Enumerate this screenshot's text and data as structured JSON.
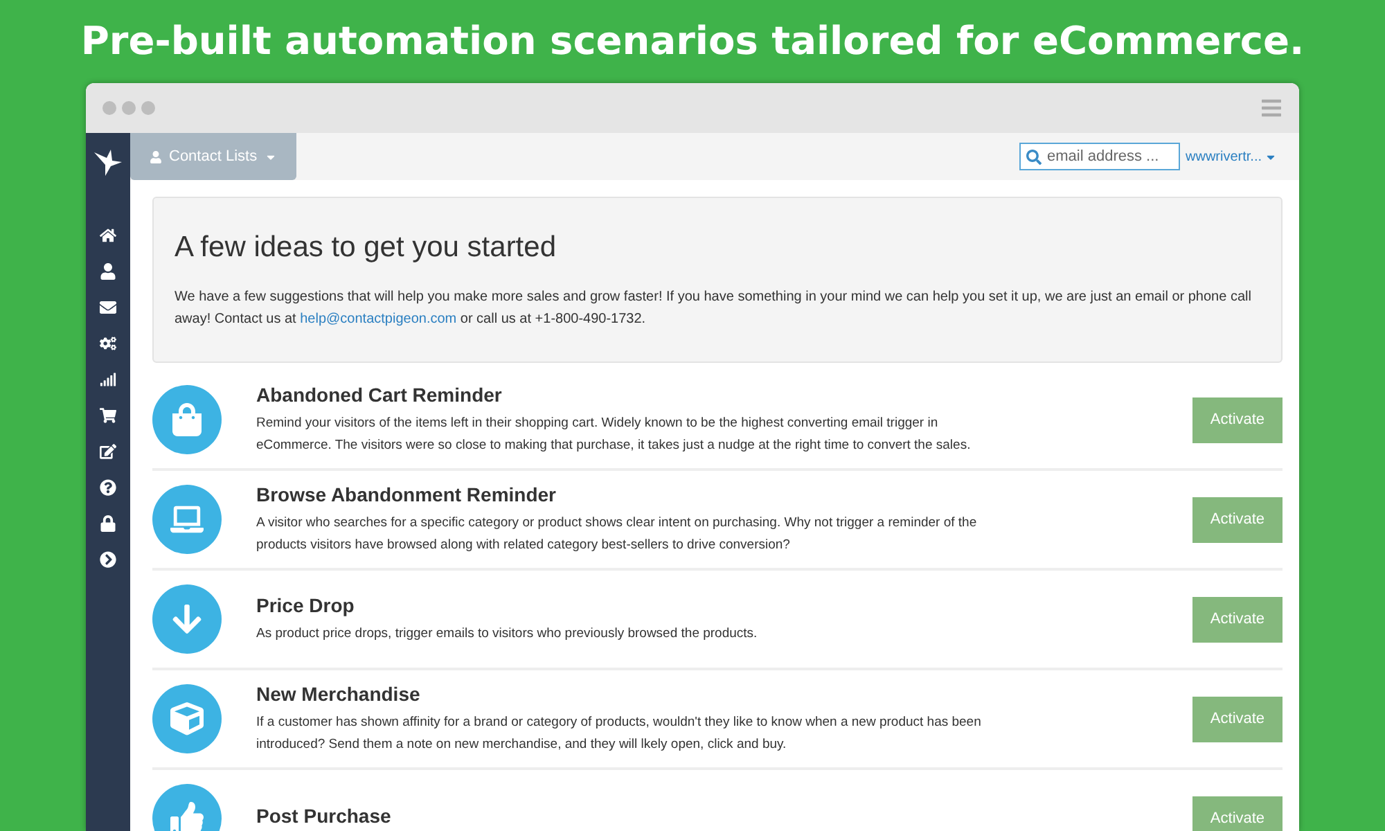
{
  "headline": "Pre-built automation scenarios tailored for eCommerce.",
  "topbar": {
    "menu_label": "Contact Lists",
    "search": {
      "placeholder": "email address ..."
    },
    "account": "wwwrivertr..."
  },
  "intro": {
    "heading": "A few ideas to get you started",
    "text_before": "We have a few suggestions that will help you make more sales and grow faster! If you have something in your mind we can help you set it up, we are just an email or phone call away! Contact us at ",
    "link": "help@contactpigeon.com",
    "text_after": " or call us at +1-800-490-1732."
  },
  "scenarios": [
    {
      "title": "Abandoned Cart Reminder",
      "description": "Remind your visitors of the items left in their shopping cart. Widely known to be the highest converting email trigger in eCommerce. The visitors were so close to making that purchase, it takes just a nudge at the right time to convert the sales.",
      "button": "Activate"
    },
    {
      "title": "Browse Abandonment Reminder",
      "description": "A visitor who searches for a specific category or product shows clear intent on purchasing. Why not trigger a reminder of the products visitors have browsed along with related category best-sellers to drive conversion?",
      "button": "Activate"
    },
    {
      "title": "Price Drop",
      "description": "As product price drops, trigger emails to visitors who previously browsed the products.",
      "button": "Activate"
    },
    {
      "title": "New Merchandise",
      "description": "If a customer has shown affinity for a brand or category of products, wouldn't they like to know when a new product has been introduced? Send them a note on new merchandise, and they will lkely open, click and buy.",
      "button": "Activate"
    },
    {
      "title": "Post Purchase",
      "button": "Activate"
    }
  ]
}
